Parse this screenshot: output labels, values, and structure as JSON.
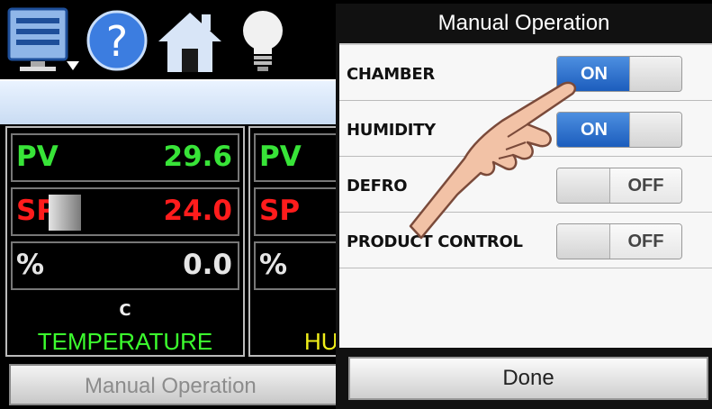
{
  "toolbar": {
    "icons": [
      "monitor-menu-icon",
      "help-icon",
      "home-icon",
      "lightbulb-icon"
    ]
  },
  "loops": [
    {
      "pv_label": "PV",
      "pv_value": "29.6",
      "sp_label": "SP",
      "sp_value": "24.0",
      "pct_label": "%",
      "pct_value": "0.0",
      "units": "C",
      "name": "TEMPERATURE"
    },
    {
      "pv_label": "PV",
      "sp_label": "SP",
      "pct_label": "%",
      "name": "HU"
    }
  ],
  "manual_button_label": "Manual Operation",
  "dialog": {
    "title": "Manual Operation",
    "items": [
      {
        "label": "CHAMBER",
        "state": "ON"
      },
      {
        "label": "HUMIDITY",
        "state": "ON"
      },
      {
        "label": "DEFRO",
        "state": "OFF"
      },
      {
        "label": "PRODUCT CONTROL",
        "state": "OFF"
      }
    ],
    "done_label": "Done"
  },
  "colors": {
    "pv": "#38e438",
    "sp": "#ff1c1c",
    "temperature_name": "#3cff2e",
    "humidity_name": "#f0ee1a",
    "toggle_on": "#2a6fd1"
  }
}
